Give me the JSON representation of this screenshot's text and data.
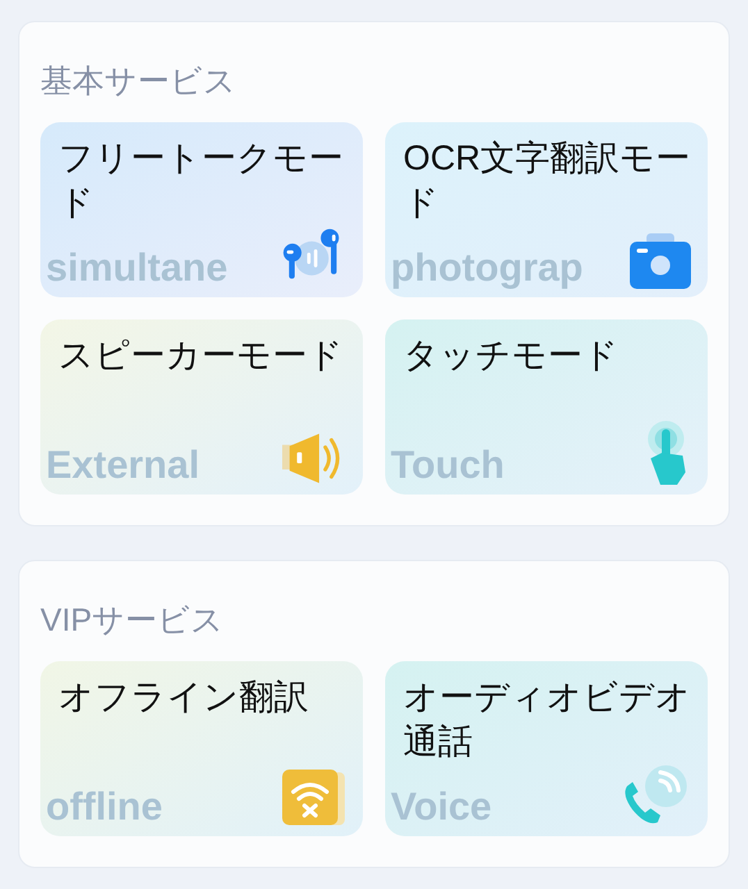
{
  "sections": [
    {
      "title": "基本サービス",
      "cards": [
        {
          "label": "フリートークモード",
          "kind": "earbuds",
          "background_text": "simultane"
        },
        {
          "label": "OCR文字翻訳モード",
          "kind": "camera",
          "background_text": "photograp"
        },
        {
          "label": "スピーカーモード",
          "kind": "speaker",
          "background_text": "External"
        },
        {
          "label": "タッチモード",
          "kind": "touch",
          "background_text": "Touch"
        }
      ]
    },
    {
      "title": "VIPサービス",
      "cards": [
        {
          "label": "オフライン翻訳",
          "kind": "offline",
          "background_text": "offline"
        },
        {
          "label": "オーディオビデオ通話",
          "kind": "call",
          "background_text": "Voice"
        }
      ]
    }
  ]
}
